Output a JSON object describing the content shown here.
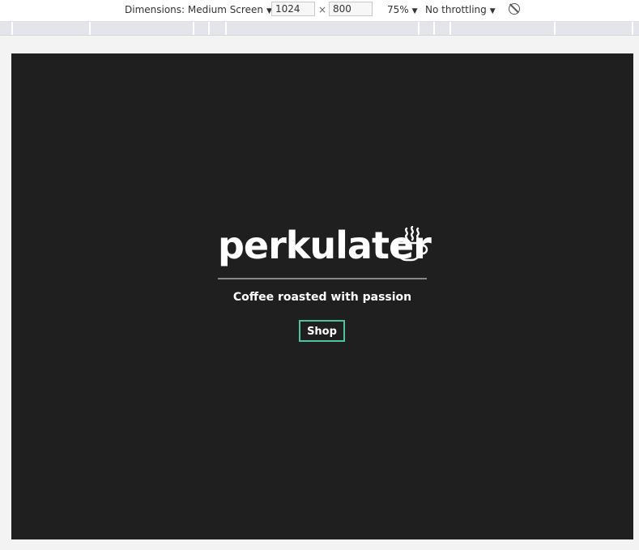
{
  "devtools": {
    "dimensions_label": "Dimensions: Medium Screen",
    "width_value": "1024",
    "times_sign": "×",
    "height_value": "800",
    "zoom_label": "75%",
    "throttling_label": "No throttling",
    "caret": "▼"
  },
  "site": {
    "logo_text": "perkulater",
    "logo_icon": "coffee-cup-icon",
    "tagline": "Coffee roasted with passion",
    "shop_label": "Shop",
    "background_color": "#1f1f1f",
    "accent_color": "#4fc3a1"
  }
}
